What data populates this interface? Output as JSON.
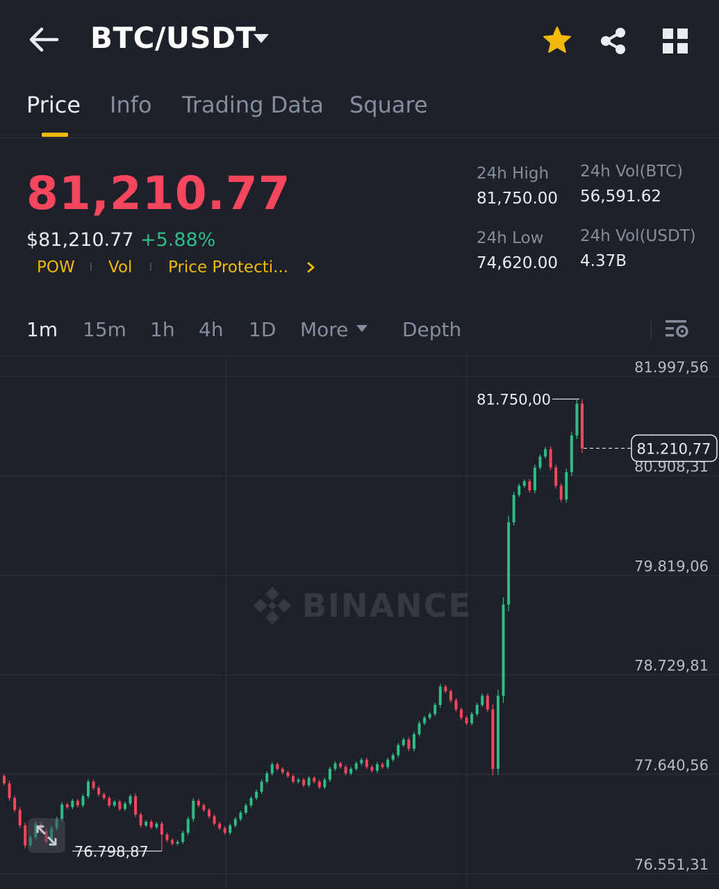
{
  "header": {
    "title": "BTC/USDT",
    "icons": {
      "back": "back-arrow-icon",
      "dropdown": "chevron-down-icon",
      "favorite": "star-icon",
      "share": "share-icon",
      "menu": "grid-icon"
    },
    "favorite_color": "#f0b90b"
  },
  "tabs": [
    {
      "label": "Price",
      "active": true
    },
    {
      "label": "Info"
    },
    {
      "label": "Trading Data"
    },
    {
      "label": "Square"
    }
  ],
  "price": {
    "last": "81,210.77",
    "usd": "$81,210.77",
    "change_pct": "+5.88%",
    "tags": [
      "POW",
      "Vol",
      "Price Protecti..."
    ]
  },
  "stats": {
    "high_label": "24h High",
    "high_value": "81,750.00",
    "low_label": "24h Low",
    "low_value": "74,620.00",
    "vol_btc_label": "24h Vol(BTC)",
    "vol_btc_value": "56,591.62",
    "vol_usdt_label": "24h Vol(USDT)",
    "vol_usdt_value": "4.37B"
  },
  "intervals": [
    "1m",
    "15m",
    "1h",
    "4h",
    "1D",
    "More",
    "Depth"
  ],
  "active_interval": "1m",
  "colors": {
    "up": "#2ebd85",
    "down": "#f6465d",
    "accent": "#f0b90b",
    "background": "#1e2129"
  },
  "chart_data": {
    "type": "candlestick",
    "watermark": "BINANCE",
    "y_ticks": [
      "81.997,56",
      "80.908,31",
      "79.819,06",
      "78.729,81",
      "77.640,56",
      "76.551,31"
    ],
    "y_tick_values": [
      81997.56,
      80908.31,
      79819.06,
      78729.81,
      77640.56,
      76551.31
    ],
    "ylim": [
      76551.31,
      81997.56
    ],
    "high_label": "81.750,00",
    "high_value": 81750.0,
    "low_label": "76.798,87",
    "low_value": 76798.87,
    "current_label": "81.210,77",
    "current_value": 81210.77,
    "closes": [
      77540,
      77380,
      77250,
      77080,
      76860,
      76950,
      77100,
      77020,
      76900,
      77050,
      77150,
      77310,
      77280,
      77350,
      77300,
      77400,
      77560,
      77490,
      77420,
      77380,
      77300,
      77340,
      77260,
      77320,
      77400,
      77200,
      77080,
      77120,
      77060,
      77100,
      76980,
      76920,
      76880,
      76900,
      77000,
      77150,
      77350,
      77300,
      77250,
      77180,
      77100,
      77050,
      77000,
      77080,
      77150,
      77220,
      77300,
      77380,
      77450,
      77560,
      77650,
      77750,
      77700,
      77660,
      77620,
      77560,
      77580,
      77520,
      77600,
      77560,
      77500,
      77580,
      77700,
      77760,
      77720,
      77650,
      77700,
      77760,
      77800,
      77720,
      77680,
      77750,
      77720,
      77800,
      77850,
      77960,
      78020,
      77920,
      78080,
      78200,
      78260,
      78300,
      78400,
      78600,
      78550,
      78450,
      78350,
      78260,
      78200,
      78300,
      78400,
      78500,
      78350,
      77700,
      78500,
      79500,
      80400,
      80700,
      80800,
      80850,
      80750,
      81000,
      81120,
      81200,
      81000,
      80800,
      80650,
      80950,
      81350,
      81700,
      81210
    ]
  }
}
